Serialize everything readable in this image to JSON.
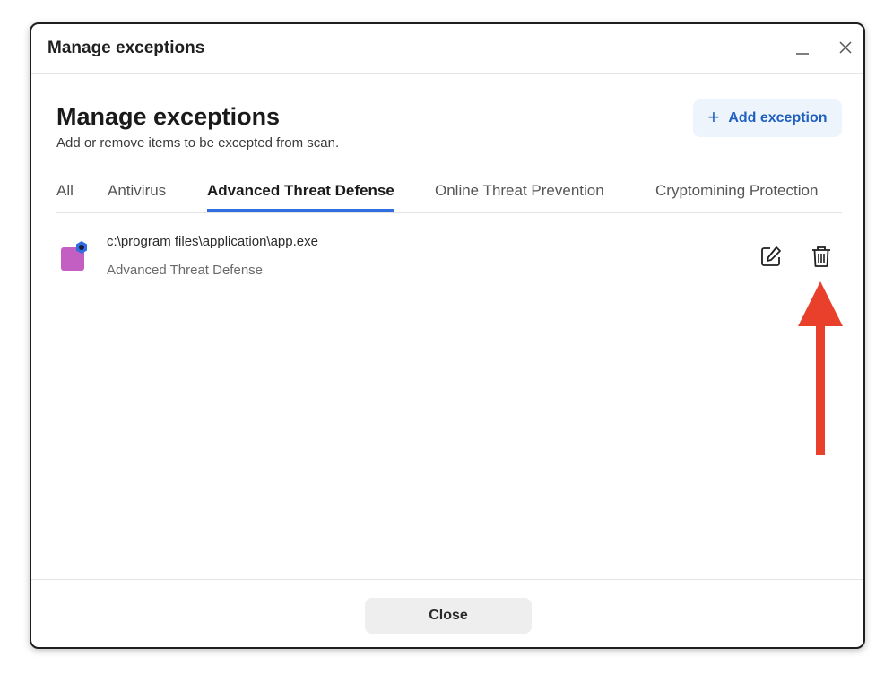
{
  "window": {
    "title": "Manage exceptions"
  },
  "header": {
    "heading": "Manage exceptions",
    "subheading": "Add or remove items to be excepted from scan.",
    "add_button_label": "Add exception"
  },
  "tabs": [
    {
      "label": "All",
      "active": false
    },
    {
      "label": "Antivirus",
      "active": false
    },
    {
      "label": "Advanced Threat Defense",
      "active": true
    },
    {
      "label": "Online Threat Prevention",
      "active": false
    },
    {
      "label": "Cryptomining Protection",
      "active": false
    }
  ],
  "exceptions": [
    {
      "path": "c:\\program files\\application\\app.exe",
      "category": "Advanced Threat Defense",
      "icon": "app-icon"
    }
  ],
  "footer": {
    "close_label": "Close"
  },
  "icons": {
    "minimize": "minimize-icon",
    "close": "close-icon",
    "edit": "edit-icon",
    "delete": "trash-icon",
    "add": "plus-icon"
  },
  "colors": {
    "accent": "#2f6fe0",
    "add_button_bg": "#eef4fb",
    "add_button_text": "#1f5fbf",
    "annotation_arrow": "#e8402b"
  }
}
